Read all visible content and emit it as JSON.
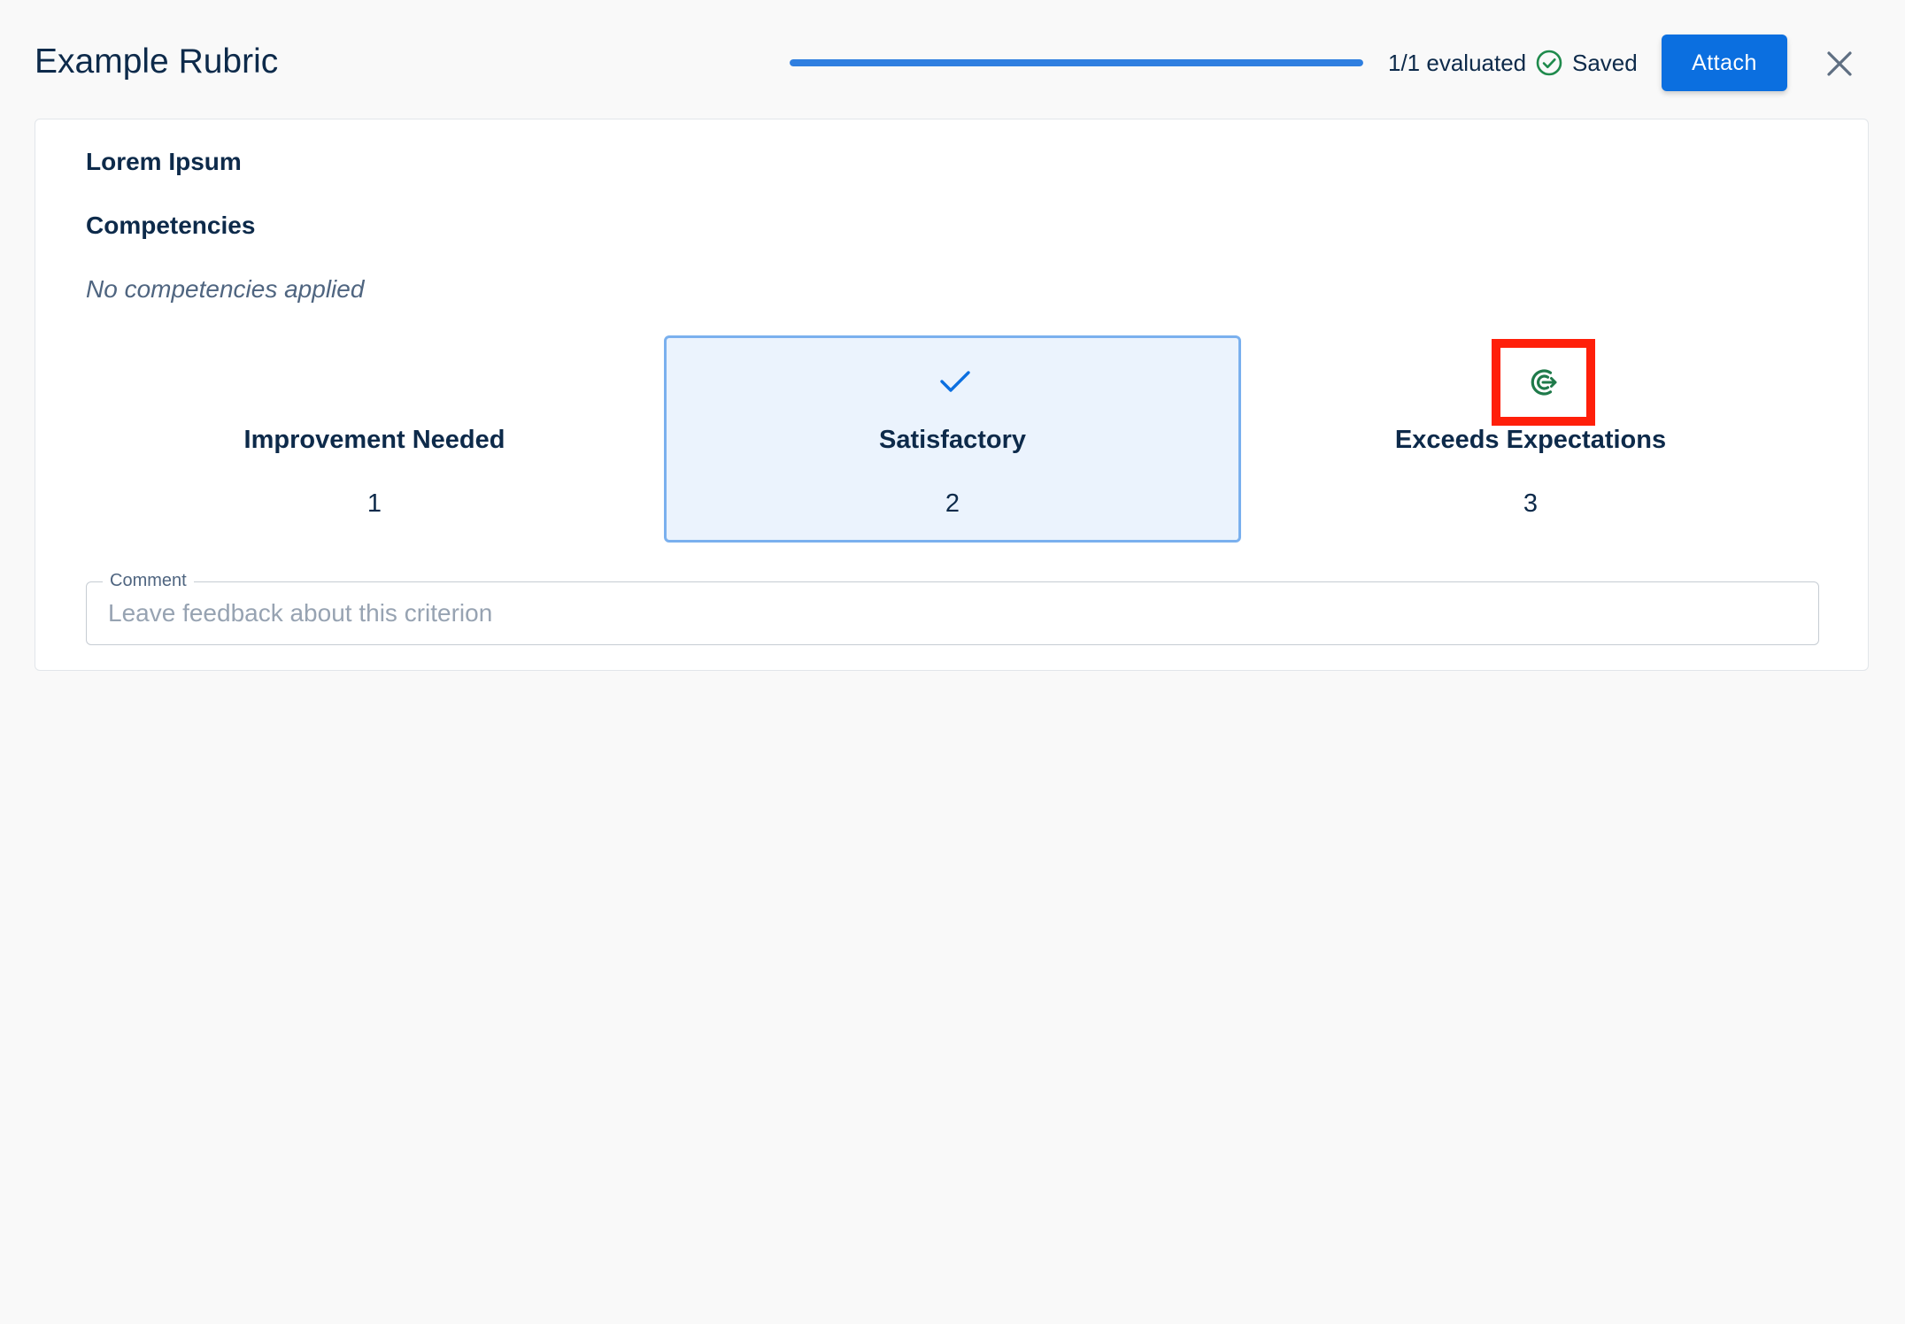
{
  "header": {
    "title": "Example Rubric",
    "progress_fraction": 1.0,
    "evaluated_text": "1/1 evaluated",
    "saved_text": "Saved",
    "attach_label": "Attach"
  },
  "criterion": {
    "title": "Lorem Ipsum",
    "competencies_heading": "Competencies",
    "competencies_empty": "No competencies applied",
    "levels": [
      {
        "name": "Improvement Needed",
        "points": "1",
        "selected": false
      },
      {
        "name": "Satisfactory",
        "points": "2",
        "selected": true
      },
      {
        "name": "Exceeds Expectations",
        "points": "3",
        "selected": false
      }
    ],
    "comment": {
      "label": "Comment",
      "placeholder": "Leave feedback about this criterion",
      "value": ""
    }
  },
  "colors": {
    "accent": "#0b6fe0",
    "progress": "#2f7fe0",
    "saved_green": "#1f8a4c",
    "selected_bg": "#ebf3fd",
    "selected_border": "#7ab0ee",
    "highlight": "#ff1f0a"
  },
  "icons": {
    "saved": "check-circle-icon",
    "close": "close-icon",
    "selected_level": "checkmark-icon",
    "highlighted": "brand-logo-icon"
  }
}
